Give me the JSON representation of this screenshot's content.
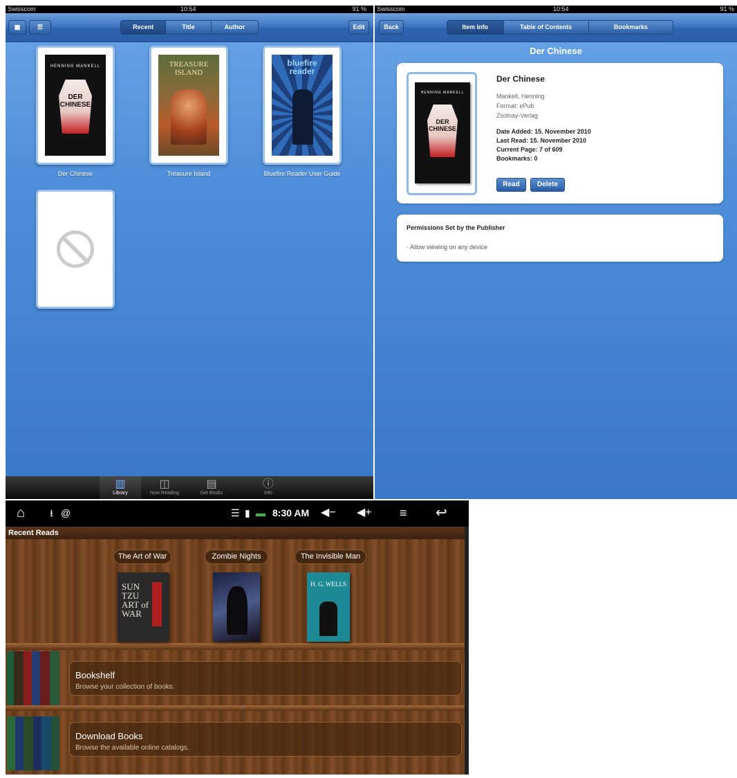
{
  "left_ipad": {
    "status": {
      "carrier": "Swisscom",
      "time": "10:54",
      "battery": "91 %"
    },
    "toolbar": {
      "grid_icon": "grid-icon",
      "list_icon": "list-icon",
      "sort_tabs": [
        "Recent",
        "Title",
        "Author"
      ],
      "selected": "Recent",
      "edit": "Edit"
    },
    "books": [
      {
        "title": "Der Chinese",
        "cover_top": "HENNING MANKELL",
        "cover_title": "DER\nCHINESE"
      },
      {
        "title": "Treasure Island",
        "cover_title": "TREASURE\nISLAND"
      },
      {
        "title": "Bluefire Reader User Guide",
        "cover_title": "bluefire\nreader"
      }
    ],
    "tabbar": [
      {
        "label": "Library",
        "icon": "library-icon",
        "selected": true
      },
      {
        "label": "Now Reading",
        "icon": "book-open-icon",
        "selected": false
      },
      {
        "label": "Get Books",
        "icon": "download-icon",
        "selected": false
      },
      {
        "label": "Info",
        "icon": "info-icon",
        "selected": false
      }
    ]
  },
  "right_ipad": {
    "status": {
      "carrier": "Swisscom",
      "time": "10:54",
      "battery": "91 %"
    },
    "back": "Back",
    "tabs": [
      "Item Info",
      "Table of Contents",
      "Bookmarks"
    ],
    "selected_tab": "Item Info",
    "page_title": "Der Chinese",
    "item": {
      "title": "Der Chinese",
      "author": "Mankell, Henning",
      "format": "Format: ePub",
      "publisher": "Zsolnay-Verlag",
      "date_added": "Date Added: 15. November 2010",
      "last_read": "Last Read: 15. November 2010",
      "current_page": "Current Page: 7 of 609",
      "bookmarks": "Bookmarks: 0",
      "read": "Read",
      "delete": "Delete"
    },
    "permissions": {
      "title": "Permissions Set by the Publisher",
      "item": "· Allow viewing on any device"
    }
  },
  "android": {
    "status": {
      "time": "8:30 AM"
    },
    "section": "Recent Reads",
    "recent": [
      {
        "title": "The Art of War",
        "cover": "SUN\nTZU\nART of\nWAR"
      },
      {
        "title": "Zombie Nights",
        "cover": ""
      },
      {
        "title": "The Invisible Man",
        "cover": "H. G. WELLS"
      }
    ],
    "menu": [
      {
        "title": "Bookshelf",
        "subtitle": "Browse your collection of books."
      },
      {
        "title": "Download Books",
        "subtitle": "Browse the available online catalogs."
      }
    ]
  },
  "colors": {
    "ipad_blue": "#4f8fd9",
    "wood": "#6b3f1c"
  }
}
